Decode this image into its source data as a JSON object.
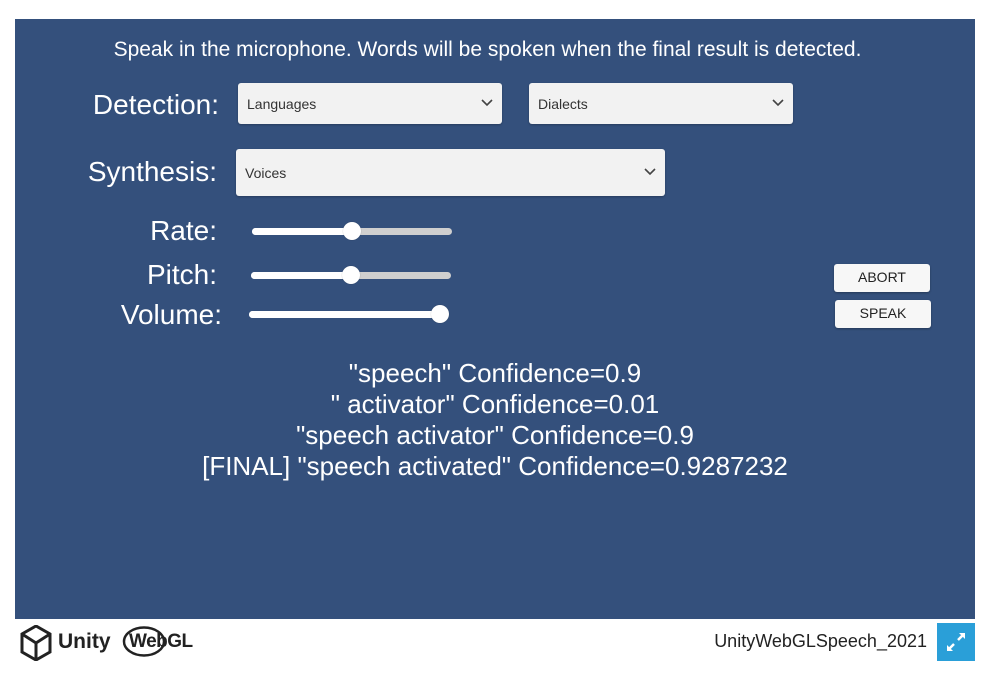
{
  "header": {
    "instruction": "Speak in the microphone. Words will be spoken when the final result is detected."
  },
  "detection": {
    "label": "Detection:",
    "languages": {
      "selected": "Languages"
    },
    "dialects": {
      "selected": "Dialects"
    }
  },
  "synthesis": {
    "label": "Synthesis:",
    "voices": {
      "selected": "Voices"
    }
  },
  "sliders": {
    "rate": {
      "label": "Rate:",
      "value": 0.5
    },
    "pitch": {
      "label": "Pitch:",
      "value": 0.5
    },
    "volume": {
      "label": "Volume:",
      "value": 1.0
    }
  },
  "buttons": {
    "abort": "ABORT",
    "speak": "SPEAK"
  },
  "results": [
    "\"speech\" Confidence=0.9",
    "\" activator\" Confidence=0.01",
    "\"speech activator\" Confidence=0.9",
    "[FINAL] \"speech activated\" Confidence=0.9287232"
  ],
  "footer": {
    "brand_unity": "Unity",
    "brand_webgl": "WebGL",
    "project_title": "UnityWebGLSpeech_2021",
    "fullscreen_icon": "fullscreen-icon"
  },
  "colors": {
    "canvas_bg": "#34507c",
    "fullscreen_bg": "#2a9fd8"
  }
}
